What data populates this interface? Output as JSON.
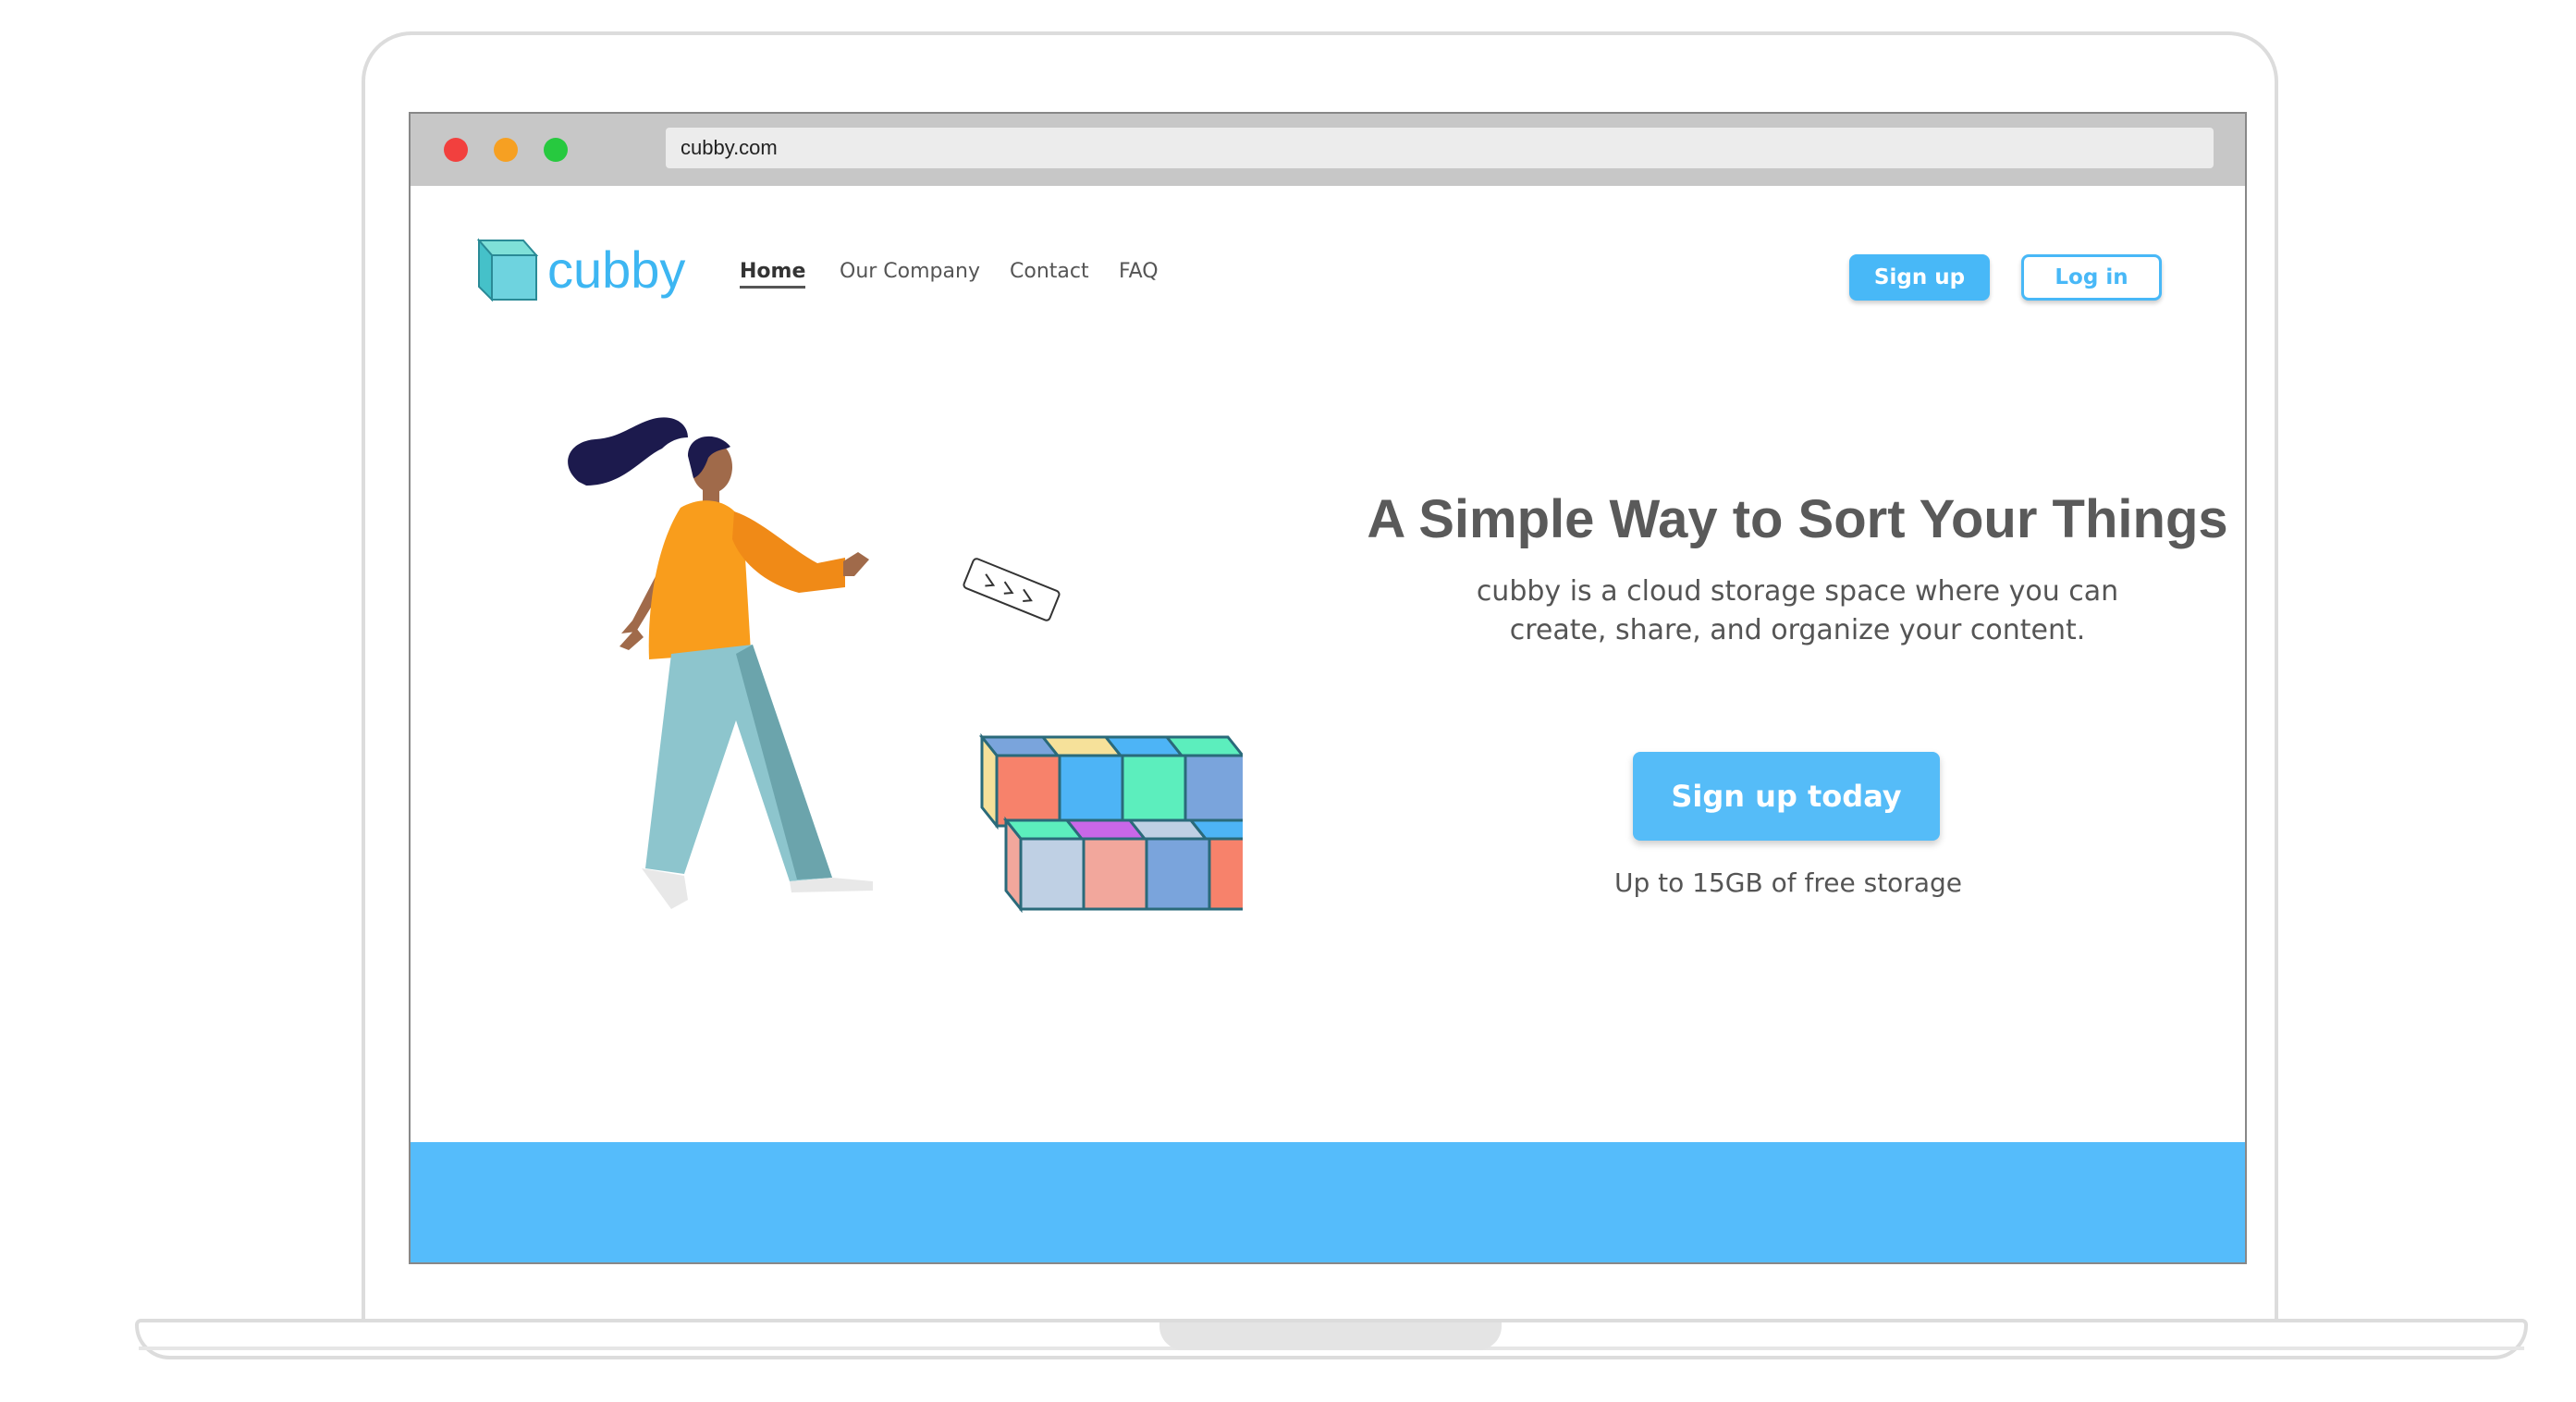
{
  "browser": {
    "url": "cubby.com"
  },
  "header": {
    "logo_text": "cubby",
    "nav": [
      {
        "label": "Home",
        "active": true
      },
      {
        "label": "Our Company",
        "active": false
      },
      {
        "label": "Contact",
        "active": false
      },
      {
        "label": "FAQ",
        "active": false
      }
    ],
    "signup_label": "Sign up",
    "login_label": "Log in"
  },
  "hero": {
    "headline": "A Simple Way to Sort Your Things",
    "subtext_line1": "cubby is a cloud storage space where you can",
    "subtext_line2": "create, share, and organize your content.",
    "cta_label": "Sign up today",
    "storage_note": "Up to 15GB of free storage"
  },
  "colors": {
    "accent": "#55bcf8",
    "logo": "#3db6f2",
    "footer": "#55bcfb"
  },
  "icons": {
    "logo": "cube-icon",
    "window_controls": [
      "close-dot",
      "minimize-dot",
      "maximize-dot"
    ]
  }
}
